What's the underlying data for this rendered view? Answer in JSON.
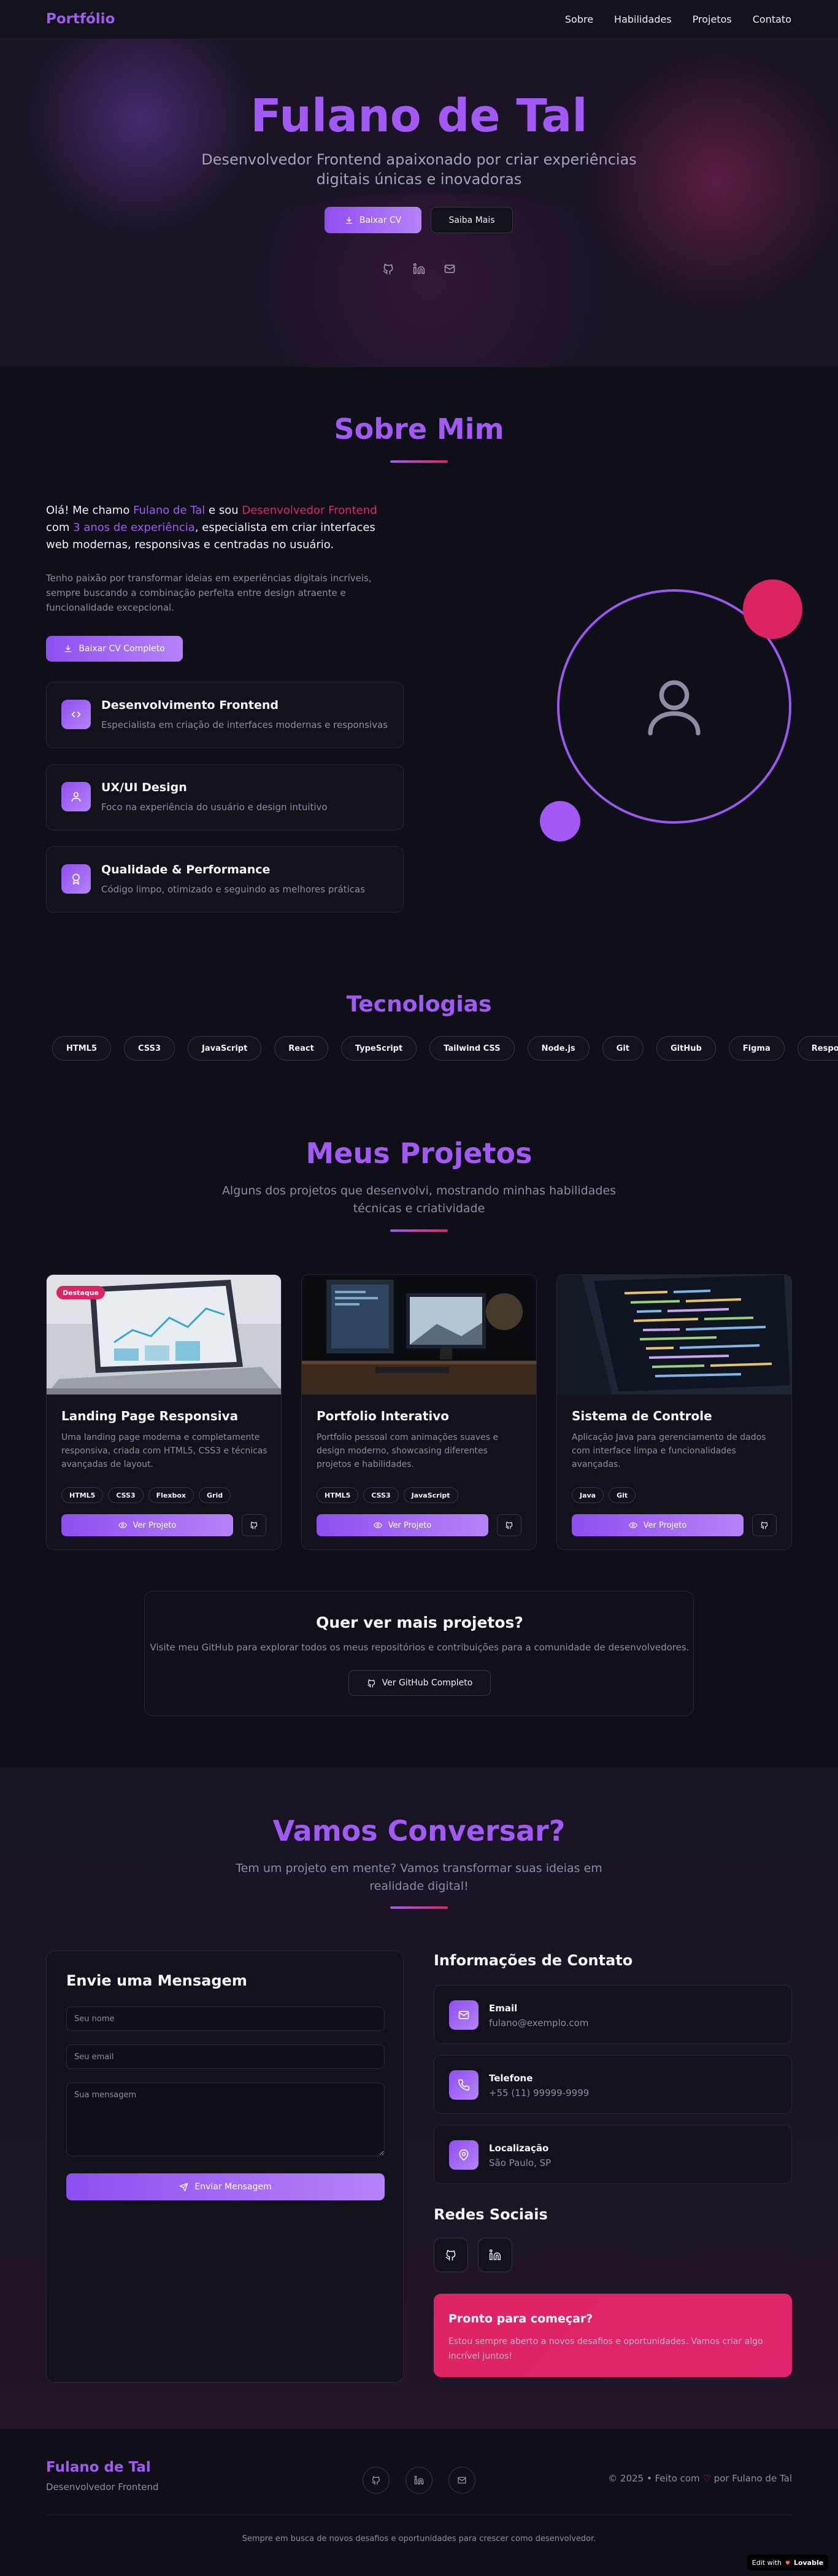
{
  "nav": {
    "brand": "Portfólio",
    "links": [
      "Sobre",
      "Habilidades",
      "Projetos",
      "Contato"
    ]
  },
  "hero": {
    "name": "Fulano de Tal",
    "subtitle": "Desenvolvedor Frontend apaixonado por criar experiências digitais únicas e inovadoras",
    "cv_button": "Baixar CV",
    "more_button": "Saiba Mais",
    "social_icons": [
      "github-icon",
      "linkedin-icon",
      "mail-icon"
    ]
  },
  "about": {
    "title": "Sobre Mim",
    "intro_1": "Olá! Me chamo ",
    "intro_name": "Fulano de Tal",
    "intro_2": " e sou ",
    "intro_role": "Desenvolvedor Frontend",
    "intro_3": " com ",
    "intro_years": "3 anos de experiência",
    "intro_4": ", especialista em criar interfaces web modernas, responsivas e centradas no usuário.",
    "paragraph": "Tenho paixão por transformar ideias em experiências digitais incríveis, sempre buscando a combinação perfeita entre design atraente e funcionalidade excepcional.",
    "cv_button": "Baixar CV Completo",
    "features": [
      {
        "icon": "code-icon",
        "title": "Desenvolvimento Frontend",
        "desc": "Especialista em criação de interfaces modernas e responsivas"
      },
      {
        "icon": "user-icon",
        "title": "UX/UI Design",
        "desc": "Foco na experiência do usuário e design intuitivo"
      },
      {
        "icon": "award-icon",
        "title": "Qualidade & Performance",
        "desc": "Código limpo, otimizado e seguindo as melhores práticas"
      }
    ]
  },
  "tech": {
    "title": "Tecnologias",
    "items": [
      "HTML5",
      "CSS3",
      "JavaScript",
      "React",
      "TypeScript",
      "Tailwind CSS",
      "Node.js",
      "Git",
      "GitHub",
      "Figma",
      "Responsive"
    ]
  },
  "projects": {
    "title": "Meus Projetos",
    "subtitle": "Alguns dos projetos que desenvolvi, mostrando minhas habilidades técnicas e criatividade",
    "view_label": "Ver Projeto",
    "cards": [
      {
        "badge": "Destaque",
        "title": "Landing Page Responsiva",
        "desc": "Uma landing page moderna e completamente responsiva, criada com HTML5, CSS3 e técnicas avançadas de layout.",
        "tags": [
          "HTML5",
          "CSS3",
          "Flexbox",
          "Grid"
        ]
      },
      {
        "title": "Portfolio Interativo",
        "desc": "Portfolio pessoal com animações suaves e design moderno, showcasing diferentes projetos e habilidades.",
        "tags": [
          "HTML5",
          "CSS3",
          "JavaScript"
        ]
      },
      {
        "title": "Sistema de Controle",
        "desc": "Aplicação Java para gerenciamento de dados com interface limpa e funcionalidades avançadas.",
        "tags": [
          "Java",
          "Git"
        ]
      }
    ],
    "more_title": "Quer ver mais projetos?",
    "more_desc": "Visite meu GitHub para explorar todos os meus repositórios e contribuições para a comunidade de desenvolvedores.",
    "more_button": "Ver GitHub Completo"
  },
  "contact": {
    "title": "Vamos Conversar?",
    "subtitle": "Tem um projeto em mente? Vamos transformar suas ideias em realidade digital!",
    "form_title": "Envie uma Mensagem",
    "name_placeholder": "Seu nome",
    "email_placeholder": "Seu email",
    "message_placeholder": "Sua mensagem",
    "send_button": "Enviar Mensagem",
    "info_title": "Informações de Contato",
    "info": [
      {
        "icon": "mail-icon",
        "label": "Email",
        "value": "fulano@exemplo.com"
      },
      {
        "icon": "phone-icon",
        "label": "Telefone",
        "value": "+55 (11) 99999-9999"
      },
      {
        "icon": "map-pin-icon",
        "label": "Localização",
        "value": "São Paulo, SP"
      }
    ],
    "social_title": "Redes Sociais",
    "ready_title": "Pronto para começar?",
    "ready_desc": "Estou sempre aberto a novos desafios e oportunidades. Vamos criar algo incrível juntos!"
  },
  "footer": {
    "brand": "Fulano de Tal",
    "tagline": "Desenvolvedor Frontend",
    "copy_1": "© 2025 • Feito com ",
    "copy_heart": "♡",
    "copy_2": " por Fulano de Tal",
    "bottom": "Sempre em busca de novos desafios e oportunidades para crescer como desenvolvedor.",
    "edit_with": "Edit with",
    "lovable": "Lovable"
  },
  "colors": {
    "accent": "#a259f5",
    "pink": "#dc2462",
    "background": "#0e0f17"
  }
}
